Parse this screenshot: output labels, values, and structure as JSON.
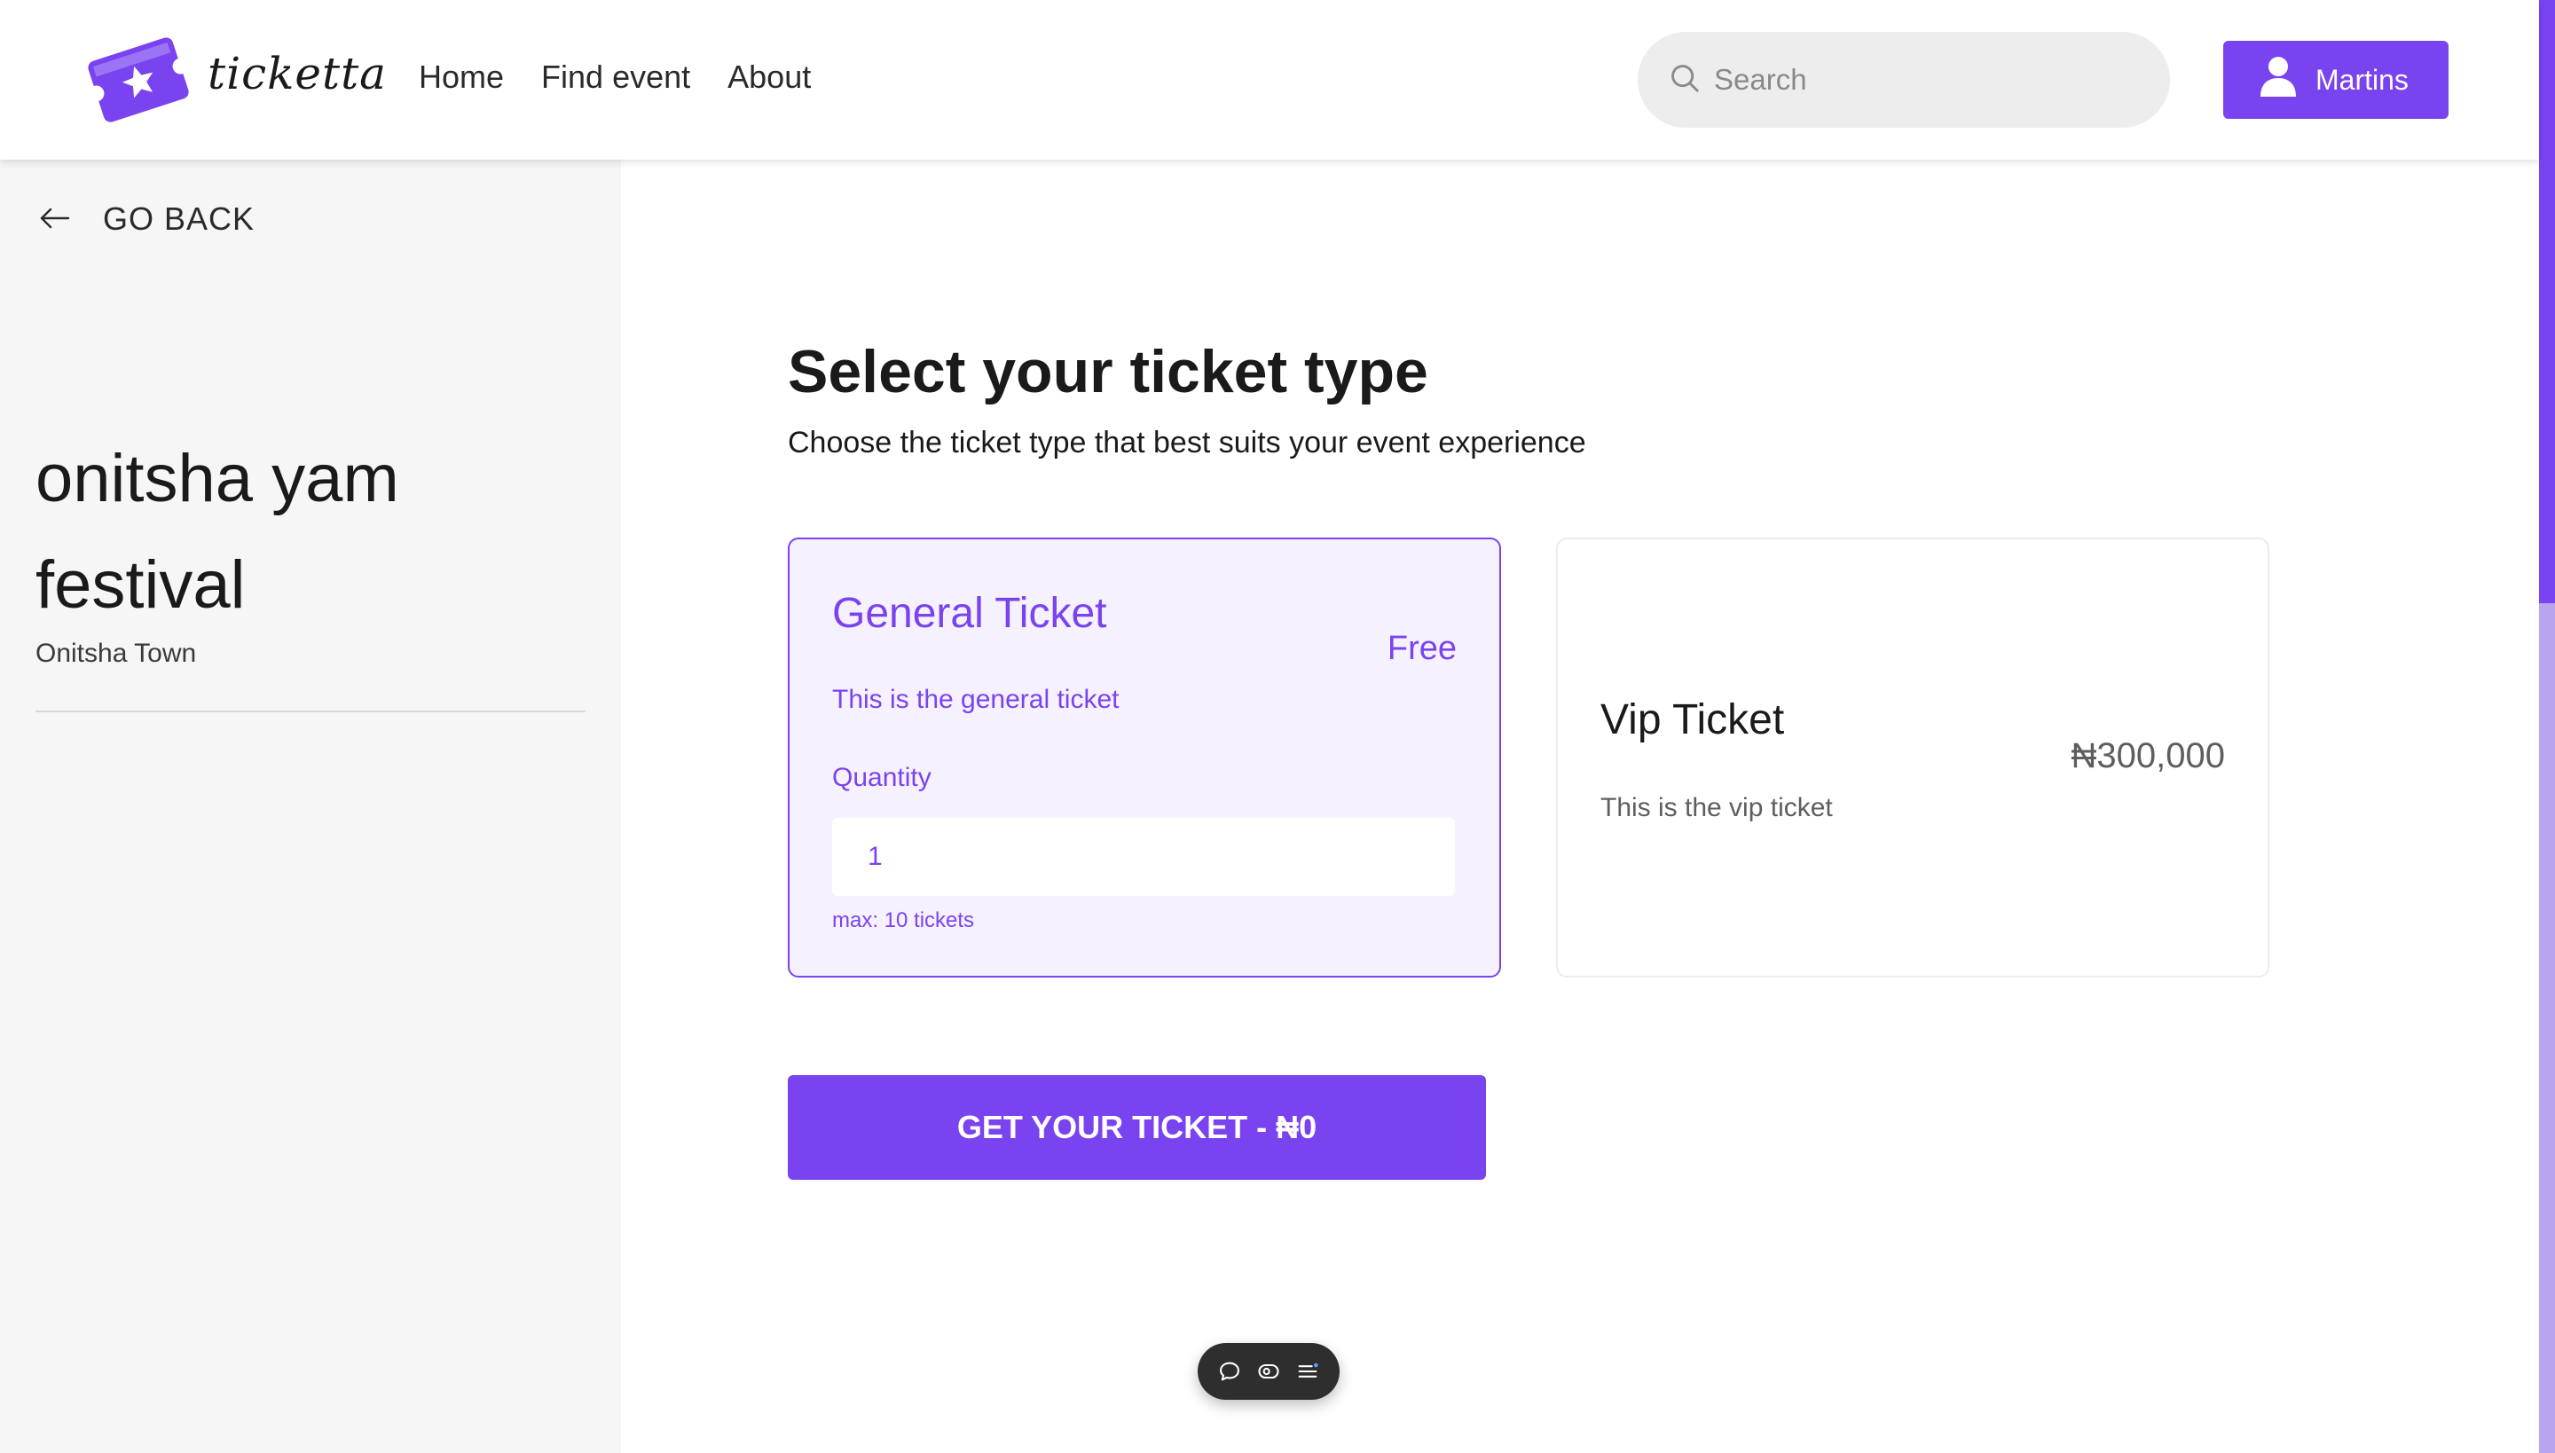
{
  "header": {
    "logo_text": "ticketta",
    "nav": [
      {
        "label": "Home"
      },
      {
        "label": "Find event"
      },
      {
        "label": "About"
      }
    ],
    "search": {
      "placeholder": "Search"
    },
    "user": {
      "name": "Martins"
    }
  },
  "sidebar": {
    "back_label": "GO BACK",
    "event_title": "onitsha yam festival",
    "event_location": "Onitsha Town"
  },
  "main": {
    "title": "Select your ticket type",
    "subtitle": "Choose the ticket type that best suits your event experience",
    "tickets": [
      {
        "name": "General Ticket",
        "price": "Free",
        "description": "This is the general ticket",
        "quantity_label": "Quantity",
        "quantity_value": "1",
        "max_note": "max: 10 tickets",
        "selected": true
      },
      {
        "name": "Vip Ticket",
        "price": "₦300,000",
        "description": "This is the vip ticket",
        "selected": false
      }
    ],
    "cta_label": "GET YOUR TICKET - ₦0"
  },
  "colors": {
    "accent": "#7a43f0",
    "selected_card_bg": "#f5f1ff",
    "sidebar_bg": "#f5f6f5"
  },
  "icons": {
    "logo": "ticket-star-icon",
    "search": "search-icon",
    "user": "user-icon",
    "back": "arrow-left-icon",
    "toolbar": [
      "comment-icon",
      "eye-icon",
      "menu-icon"
    ]
  }
}
